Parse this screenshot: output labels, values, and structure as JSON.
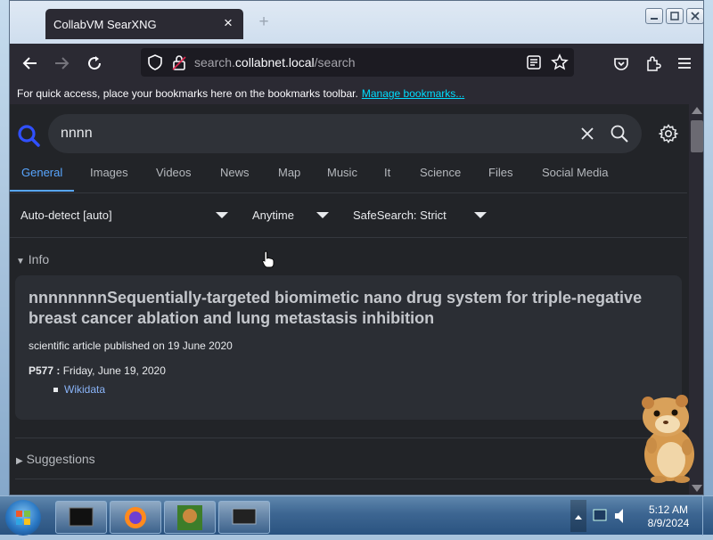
{
  "browser": {
    "tab_title": "CollabVM SearXNG",
    "url_host_prefix": "search.",
    "url_host_main": "collabnet.local",
    "url_path": "/search",
    "bookmarks_text": "For quick access, place your bookmarks here on the bookmarks toolbar.",
    "bookmarks_link": "Manage bookmarks..."
  },
  "search": {
    "query": "nnnn",
    "categories": [
      "General",
      "Images",
      "Videos",
      "News",
      "Map",
      "Music",
      "It",
      "Science",
      "Files",
      "Social Media"
    ],
    "active_category": "General",
    "language_filter": "Auto-detect [auto]",
    "time_filter": "Anytime",
    "safesearch_filter": "SafeSearch: Strict"
  },
  "infobox": {
    "header": "Info",
    "title": "nnnnnnnnSequentially-targeted biomimetic nano drug system for triple-negative breast cancer ablation and lung metastasis inhibition",
    "description": "scientific article published on 19 June 2020",
    "attribute_key": "P577 :",
    "attribute_value": "Friday, June 19, 2020",
    "link": "Wikidata"
  },
  "suggestions_header": "Suggestions",
  "taskbar": {
    "time": "5:12 AM",
    "date": "8/9/2024"
  },
  "colors": {
    "accent": "#58a6ff",
    "link": "#8ab4f8",
    "background": "#222428"
  }
}
